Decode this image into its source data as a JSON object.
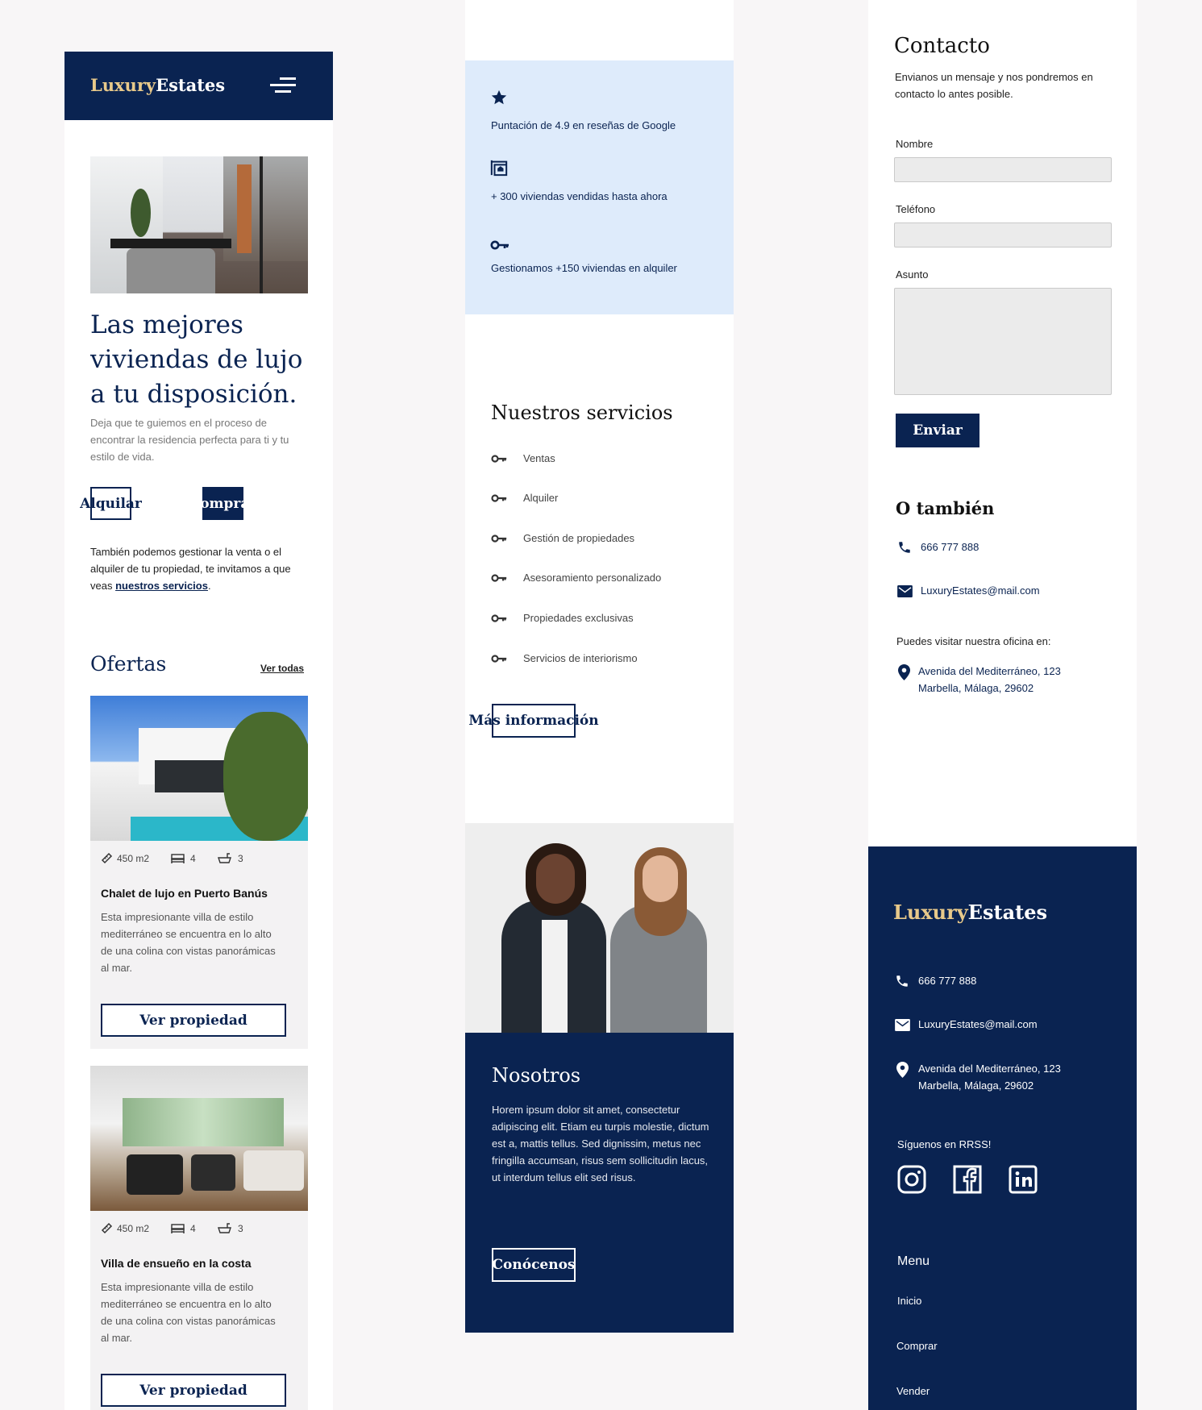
{
  "brand": {
    "part1": "Luxury",
    "part2": "Estates"
  },
  "home": {
    "hero_title": "Las mejores viviendas de lujo a tu disposición.",
    "hero_subtitle": "Deja que te guiemos en el proceso de encontrar la residencia perfecta para ti y tu estilo de vida.",
    "btn_rent": "Alquilar",
    "btn_buy": "Comprar",
    "manage_text": "También podemos gestionar la venta o el alquiler de tu propiedad, te invitamos a que veas ",
    "manage_link": "nuestros servicios",
    "manage_end": ".",
    "offers_title": "Ofertas",
    "offers_link": "Ver todas",
    "listings": [
      {
        "area": "450 m2",
        "beds": "4",
        "baths": "3",
        "title": "Chalet de lujo en Puerto Banús",
        "desc": "Esta impresionante villa de estilo mediterráneo se encuentra en lo alto de una colina con vistas panorámicas al mar.",
        "button": "Ver propiedad"
      },
      {
        "area": "450 m2",
        "beds": "4",
        "baths": "3",
        "title": "Villa de ensueño en la costa",
        "desc": "Esta impresionante villa de estilo mediterráneo se encuentra en lo alto de una colina con vistas panorámicas al mar.",
        "button": "Ver propiedad"
      }
    ]
  },
  "stats": [
    {
      "icon": "star-icon",
      "text": "Puntación de 4.9 en reseñas de Google"
    },
    {
      "icon": "house-sale-icon",
      "text": "+ 300 viviendas vendidas hasta ahora"
    },
    {
      "icon": "key-icon",
      "text": "Gestionamos +150 viviendas en alquiler"
    }
  ],
  "services": {
    "title": "Nuestros servicios",
    "items": [
      "Ventas",
      "Alquiler",
      "Gestión de propiedades",
      "Asesoramiento personalizado",
      "Propiedades exclusivas",
      "Servicios de interiorismo"
    ],
    "button": "Más información"
  },
  "about": {
    "title": "Nosotros",
    "text": "Horem ipsum dolor sit amet, consectetur adipiscing elit. Etiam eu turpis molestie, dictum est a, mattis tellus. Sed dignissim, metus nec fringilla accumsan, risus sem sollicitudin lacus, ut interdum tellus elit sed risus.",
    "button": "Conócenos"
  },
  "contact": {
    "title": "Contacto",
    "subtitle": "Envianos un mensaje y nos pondremos en contacto lo antes posible.",
    "label_name": "Nombre",
    "label_phone": "Teléfono",
    "label_subject": "Asunto",
    "submit": "Enviar",
    "also_title": "O también",
    "phone": "666 777 888",
    "email": "LuxuryEstates@mail.com",
    "office_label": "Puedes visitar nuestra oficina en:",
    "address_line1": "Avenida del Mediterráneo, 123",
    "address_line2": "Marbella, Málaga, 29602"
  },
  "footer": {
    "phone": "666 777 888",
    "email": "LuxuryEstates@mail.com",
    "address_line1": "Avenida del Mediterráneo, 123",
    "address_line2": "Marbella, Málaga, 29602",
    "social_title": "Síguenos en RRSS!",
    "menu_title": "Menu",
    "menu_items": [
      "Inicio",
      "Comprar",
      "Vender"
    ]
  },
  "colors": {
    "navy": "#0a2351",
    "gold": "#e8c98a",
    "light_blue": "#deebfb"
  }
}
